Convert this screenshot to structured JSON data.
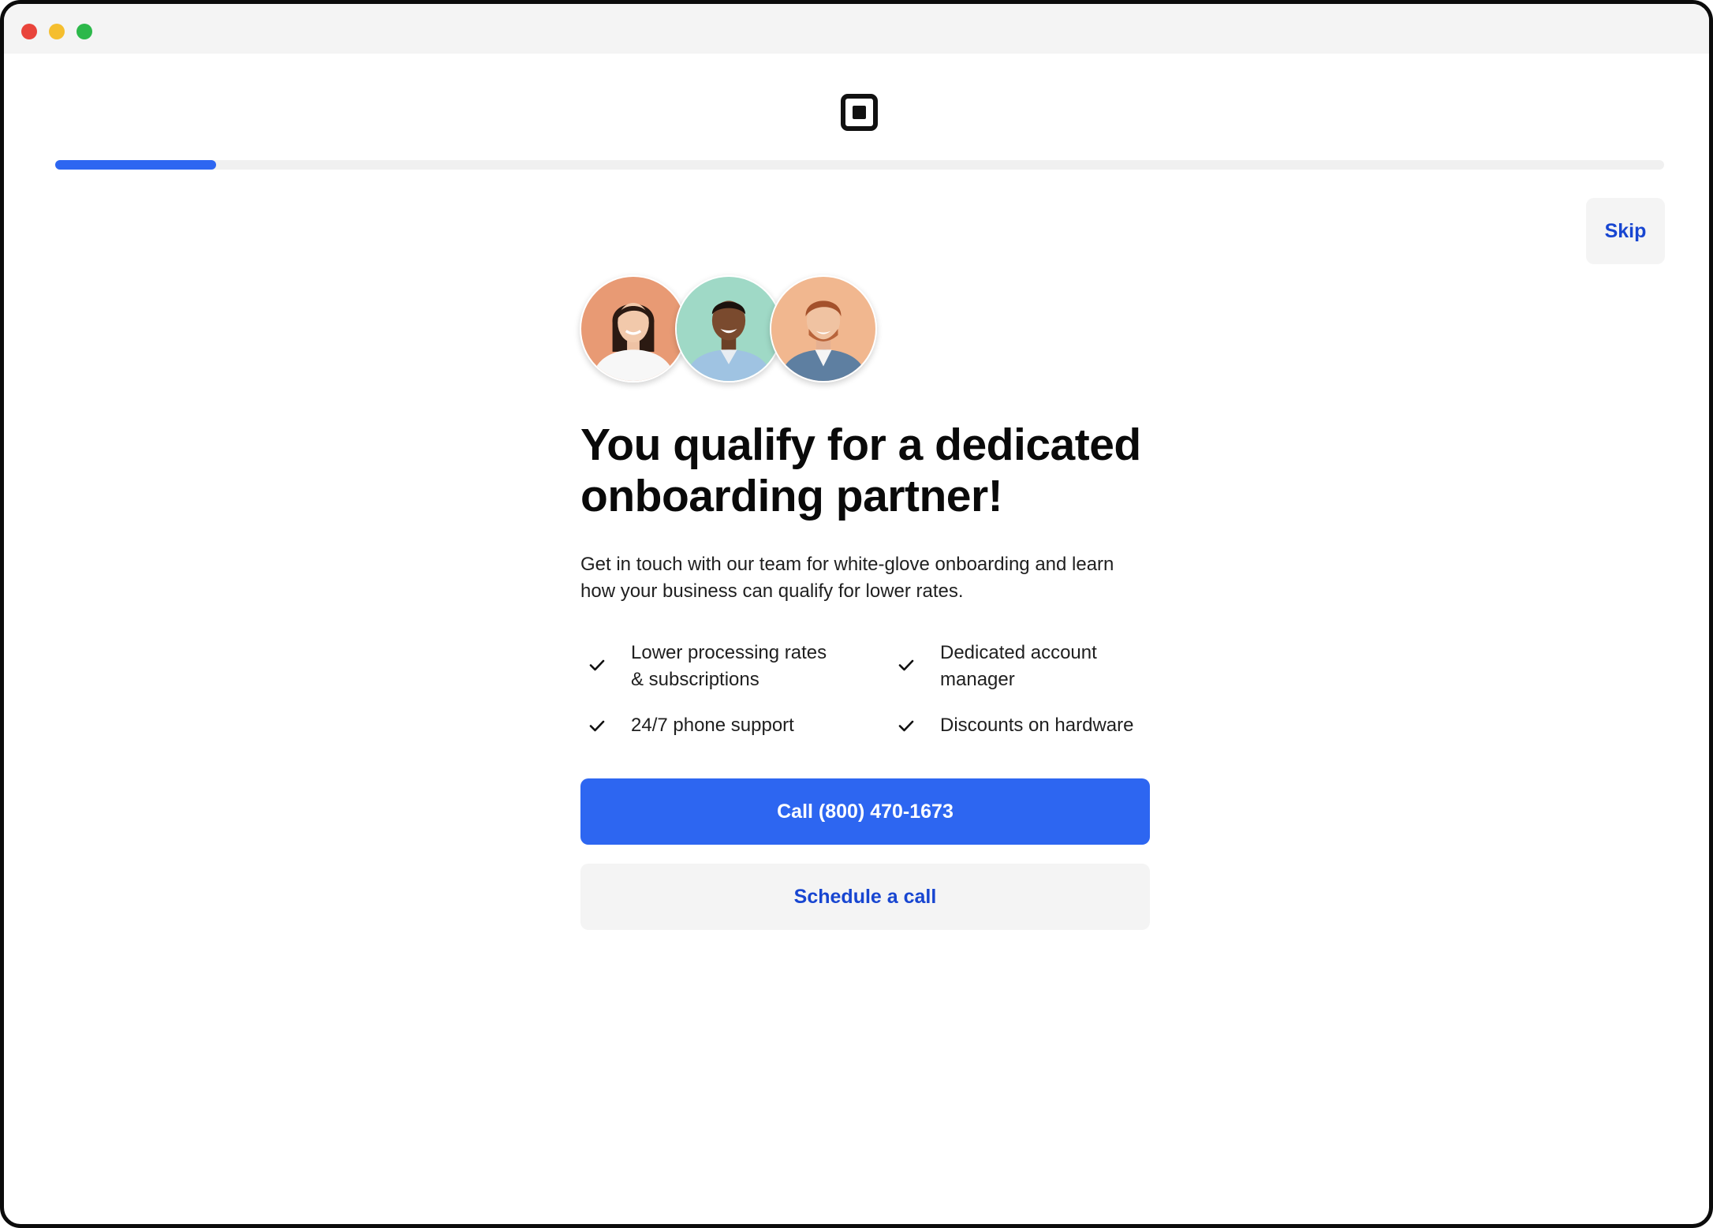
{
  "window": {
    "controls": [
      "close",
      "minimize",
      "maximize"
    ],
    "colors": {
      "close": "#e9443b",
      "minimize": "#f5be2e",
      "maximize": "#2cb84a"
    }
  },
  "header": {
    "logo_icon": "square-logo-icon"
  },
  "progress": {
    "value": 0.1
  },
  "toolbar": {
    "skip_label": "Skip"
  },
  "main": {
    "avatars": [
      "person-avatar-woman",
      "person-avatar-man",
      "person-avatar-man-redhead"
    ],
    "headline_line1": "You qualify for a dedicated",
    "headline_line2": "onboarding partner!",
    "description_line1": "Get in touch with our team for white-glove onboarding and learn",
    "description_line2": "how your business can qualify for lower rates.",
    "features": [
      {
        "line1": "Lower processing rates",
        "line2": "& subscriptions",
        "icon": "check-icon"
      },
      {
        "line1": "Dedicated account",
        "line2": "manager",
        "icon": "check-icon"
      },
      {
        "line1": "24/7 phone support",
        "icon": "check-icon"
      },
      {
        "line1": "Discounts on hardware",
        "icon": "check-icon"
      }
    ],
    "call_button_label": "Call (800) 470-1673",
    "schedule_button_label": "Schedule a call"
  },
  "colors": {
    "accent": "#2d66f1",
    "link": "#1846d1",
    "secondary_bg": "#f4f4f4"
  }
}
